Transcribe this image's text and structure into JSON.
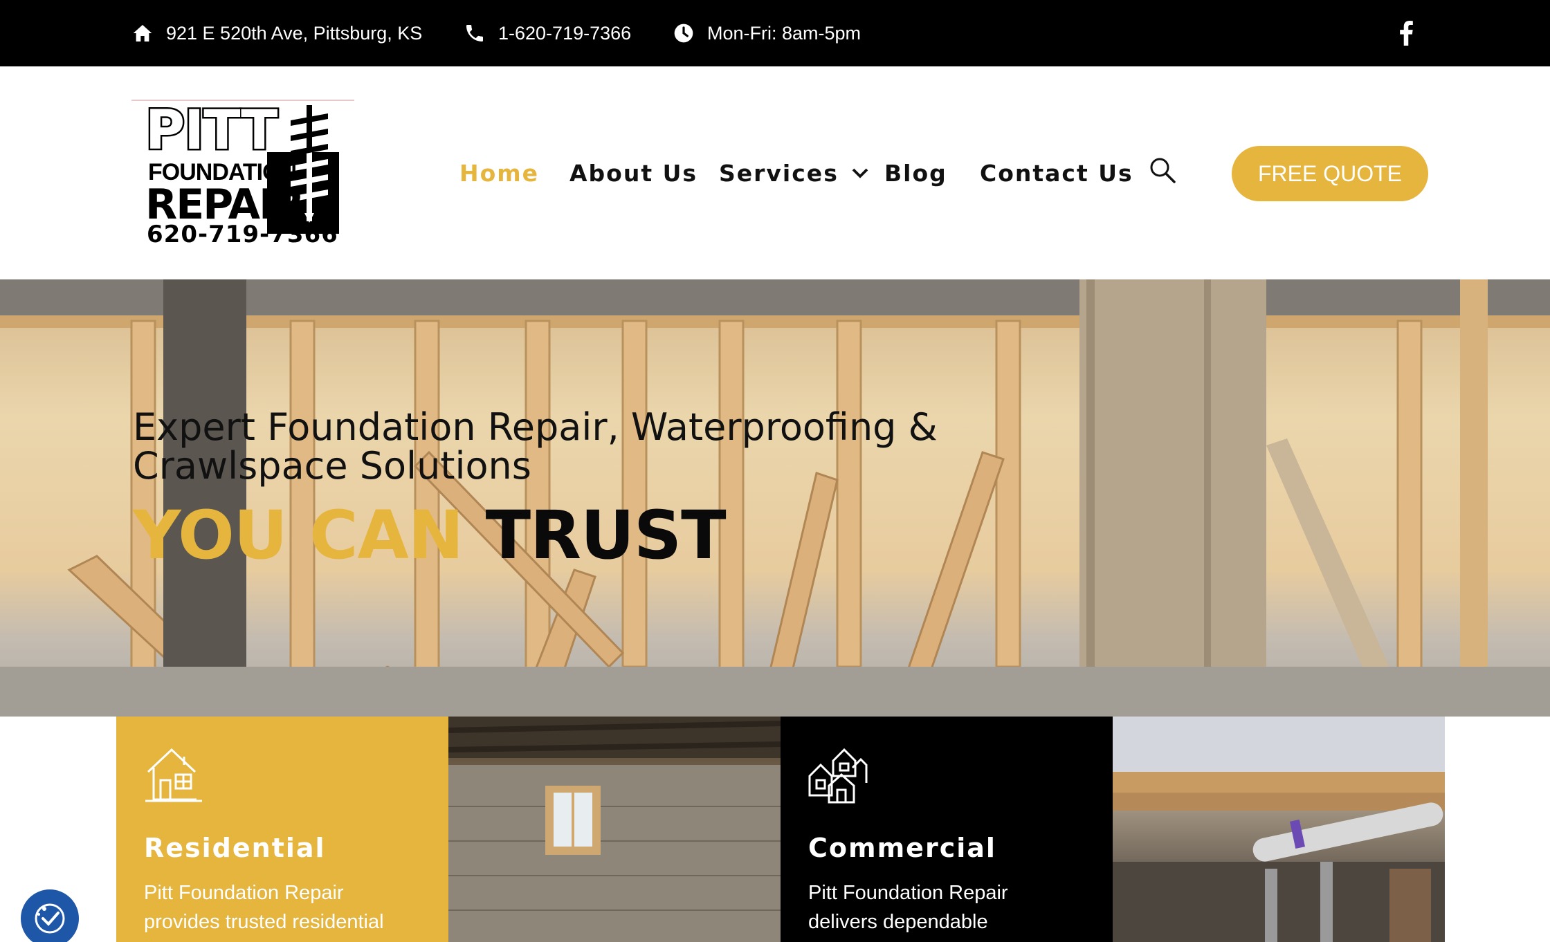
{
  "topbar": {
    "address": "921 E 520th Ave, Pittsburg, KS",
    "phone": "1-620-719-7366",
    "hours": "Mon-Fri: 8am-5pm",
    "icons": [
      "home-icon",
      "phone-icon",
      "clock-icon",
      "facebook-icon"
    ]
  },
  "logo": {
    "line1": "PITT",
    "line2": "FOUNDATION",
    "line3": "REPAIR",
    "phone": "620-719-7366"
  },
  "nav": {
    "items": [
      {
        "label": "Home",
        "active": true
      },
      {
        "label": "About Us"
      },
      {
        "label": "Services",
        "has_dropdown": true
      },
      {
        "label": "Blog"
      },
      {
        "label": "Contact Us"
      }
    ],
    "quote_label": "FREE QUOTE"
  },
  "hero": {
    "heading": "Expert Foundation Repair, Waterproofing & Crawlspace Solutions",
    "tag_highlight": "YOU CAN",
    "tag_rest": "TRUST"
  },
  "cards": [
    {
      "title": "Residential",
      "text": "Pitt Foundation Repair provides trusted residential",
      "style": "yellow",
      "icon": "house-icon"
    },
    {
      "style": "image",
      "image": "basement-photo"
    },
    {
      "title": "Commercial",
      "text": "Pitt Foundation Repair delivers dependable",
      "style": "black",
      "icon": "buildings-icon"
    },
    {
      "style": "image",
      "image": "crawlspace-photo"
    }
  ],
  "colors": {
    "accent": "#e5b53e",
    "topbar_bg": "#000000",
    "access_button": "#1e56a8"
  }
}
